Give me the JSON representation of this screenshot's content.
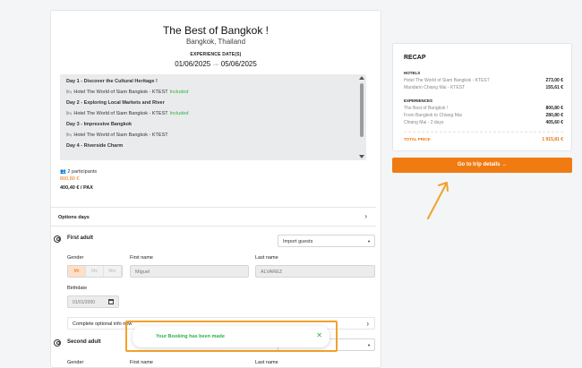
{
  "trip": {
    "title": "The Best of Bangkok !",
    "location": "Bangkok, Thailand",
    "dates_label": "EXPERIENCE DATE(S)",
    "start_date": "01/06/2025",
    "date_separator": "until",
    "end_date": "05/06/2025"
  },
  "itinerary": [
    {
      "kind": "day",
      "text": "Day 1 - Discover the Cultural Heritage !"
    },
    {
      "kind": "hotel",
      "text": "Hotel The World of Siam Bangkok - KTEST",
      "badge": "Included"
    },
    {
      "kind": "day",
      "text": "Day 2 - Exploring Local Markets and River"
    },
    {
      "kind": "hotel",
      "text": "Hotel The World of Siam Bangkok - KTEST",
      "badge": "Included"
    },
    {
      "kind": "day",
      "text": "Day 3 - Impressive Bangkok"
    },
    {
      "kind": "hotel",
      "text": "Hotel The World of Siam Bangkok - KTEST",
      "badge": ""
    },
    {
      "kind": "day",
      "text": "Day 4 - Riverside Charm"
    }
  ],
  "summary": {
    "participants": "2 participants",
    "price": "800,80 €",
    "price_per_pax": "400,40 € / PAX"
  },
  "options": {
    "label": "Options days"
  },
  "first_adult": {
    "heading": "First adult",
    "import_label": "Import guests",
    "gender_label": "Gender",
    "genders": [
      "Mr",
      "Ms",
      "Mrs"
    ],
    "first_name_label": "First name",
    "first_name_value": "Miguel",
    "last_name_label": "Last name",
    "last_name_value": "ALVAREZ",
    "birthdate_label": "Birthdate",
    "birthdate_value": "01/01/2000",
    "optional_label": "Complete optional info now"
  },
  "second_adult": {
    "heading": "Second adult",
    "gender_label": "Gender",
    "first_name_label": "First name",
    "last_name_label": "Last name"
  },
  "recap": {
    "title": "RECAP",
    "hotels_label": "HOTELS",
    "hotels": [
      {
        "name": "Hotel The World of Siam Bangkok - KTEST",
        "price": "273,00 €"
      },
      {
        "name": "Mandarin Chiang Mai - KTEST",
        "price": "155,61 €"
      }
    ],
    "experiences_label": "EXPERIENCES",
    "experiences": [
      {
        "name": "The Best of Bangkok !",
        "price": "800,80 €"
      },
      {
        "name": "From Bangkok to Chiang Mai",
        "price": "280,80 €"
      },
      {
        "name": "Chiang Mai - 2 days",
        "price": "405,60 €"
      }
    ],
    "total_label": "TOTAL PRICE",
    "total_value": "1 915,81 €"
  },
  "cta": {
    "label": "Go to trip details →"
  },
  "toast": {
    "message": "Your Booking has been made",
    "close": "✕"
  },
  "colors": {
    "accent": "#f07b12",
    "success": "#2bb04a",
    "highlight": "#f0a22a"
  },
  "icons": [
    "bed-icon",
    "users-icon",
    "chevron-right-icon",
    "user-circle-icon",
    "calendar-icon",
    "caret-down-icon",
    "close-icon",
    "arrow-annotation"
  ]
}
